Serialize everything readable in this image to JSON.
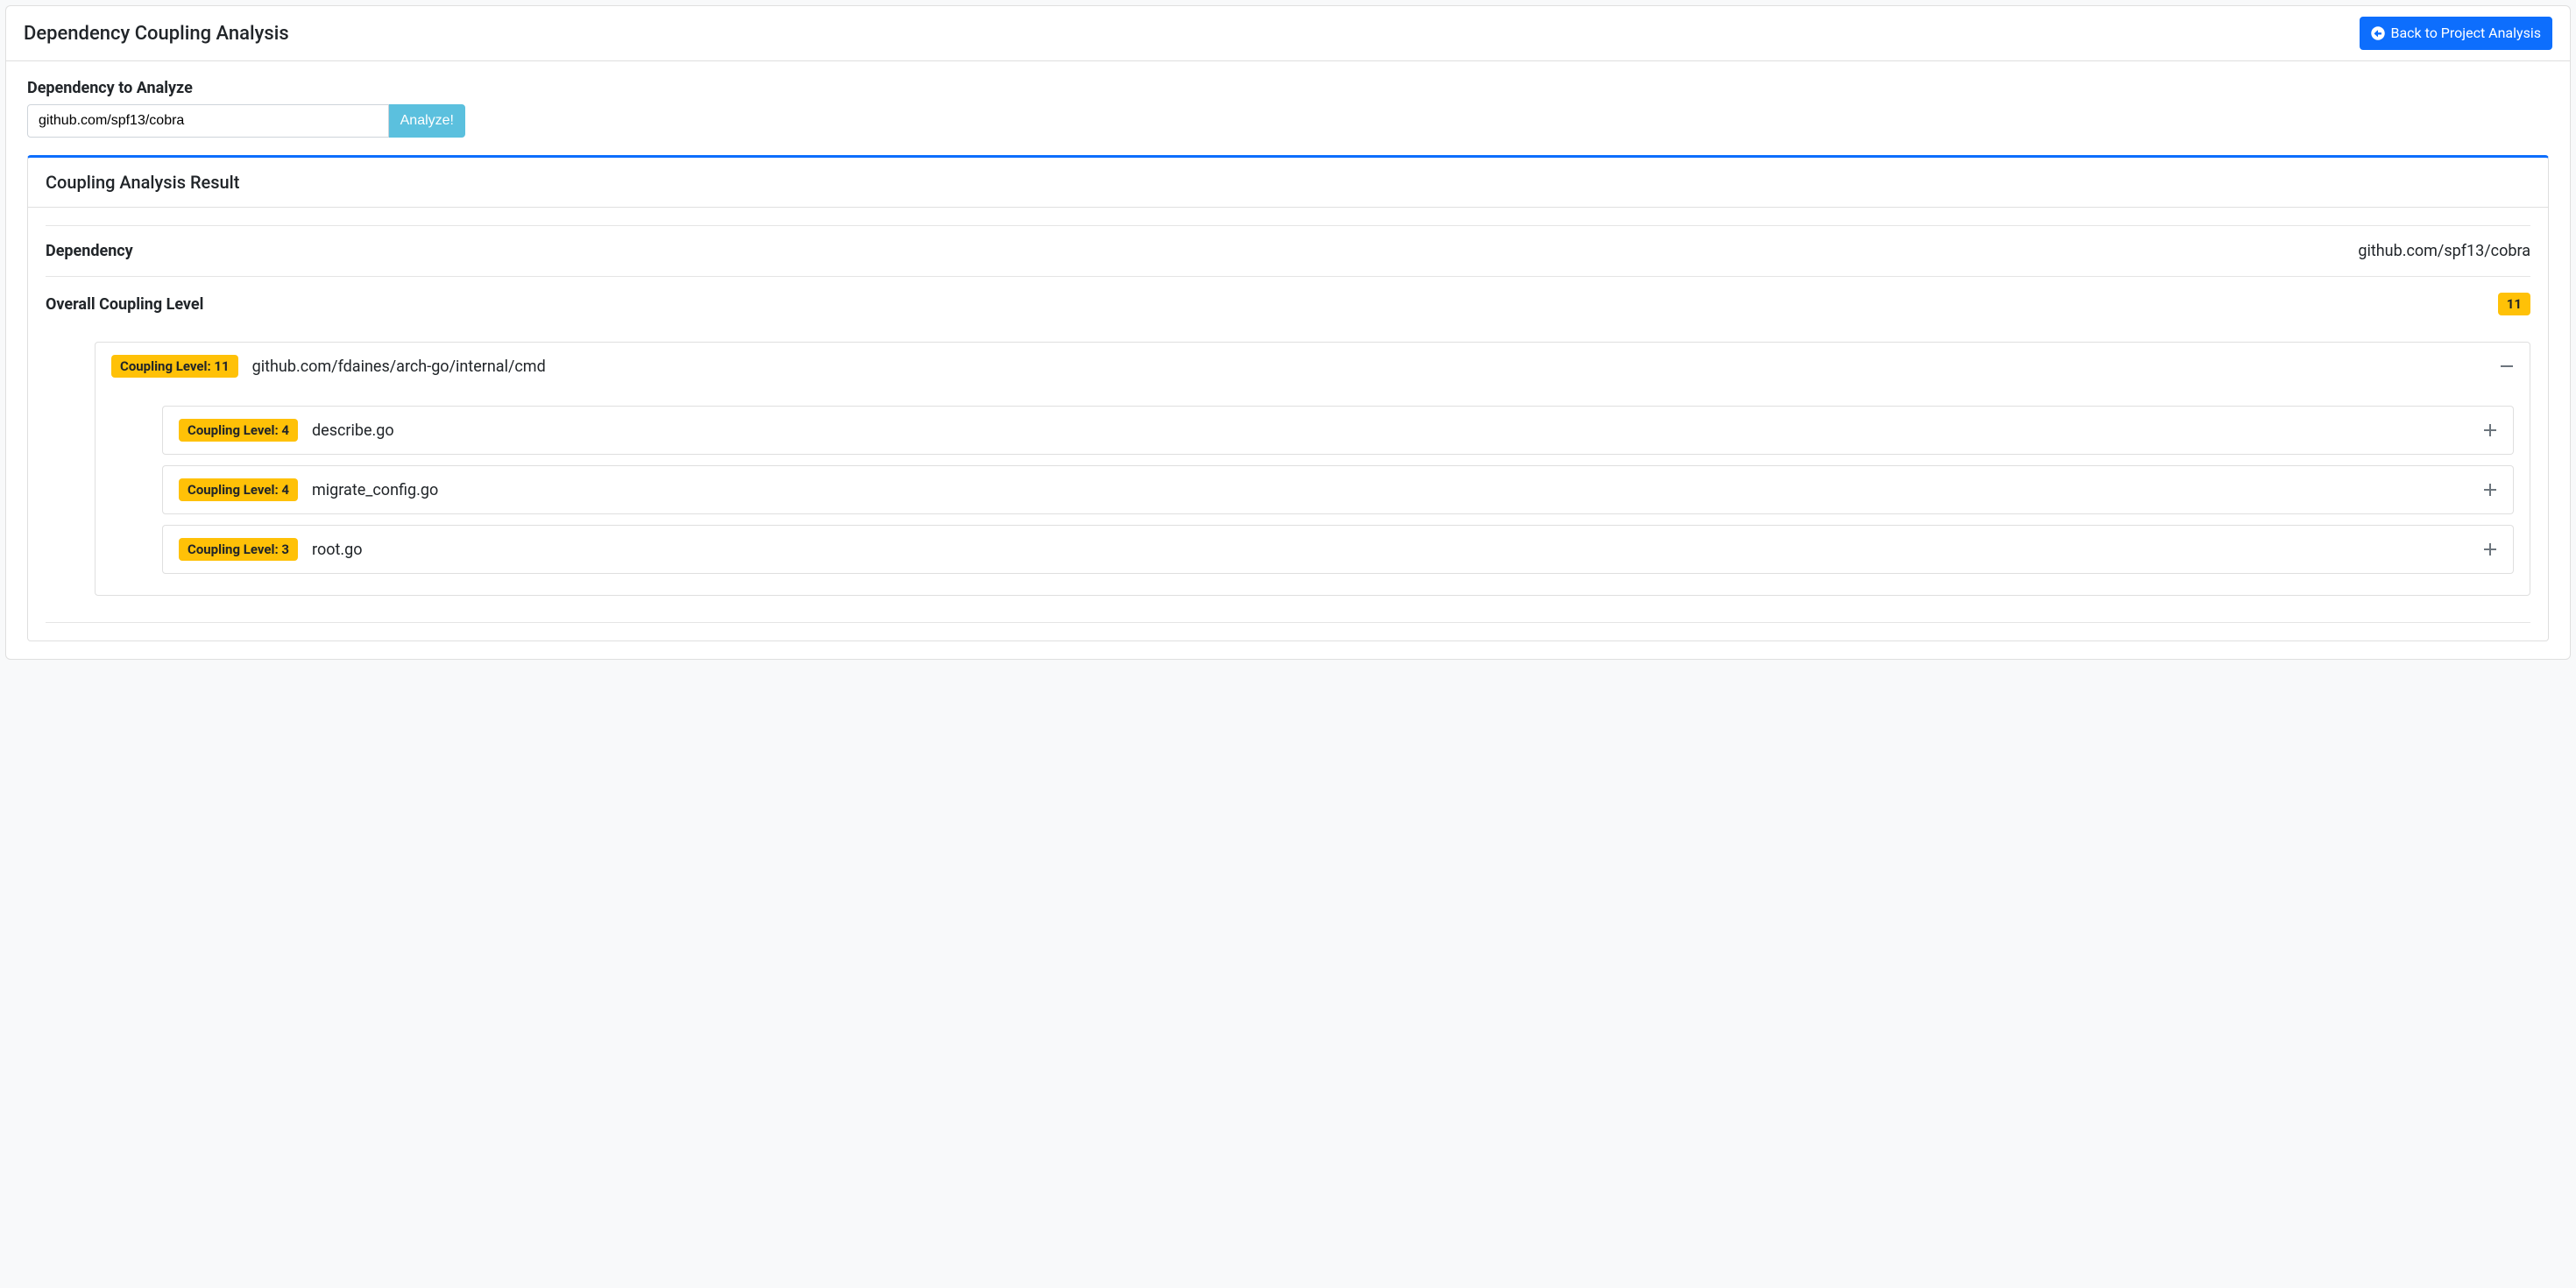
{
  "header": {
    "title": "Dependency Coupling Analysis",
    "back_button": "Back to Project Analysis"
  },
  "form": {
    "label": "Dependency to Analyze",
    "input_value": "github.com/spf13/cobra",
    "analyze_button": "Analyze!"
  },
  "result": {
    "title": "Coupling Analysis Result",
    "dependency_label": "Dependency",
    "dependency_value": "github.com/spf13/cobra",
    "overall_label": "Overall Coupling Level",
    "overall_value": "11",
    "tree": {
      "coupling_badge": "Coupling Level: 11",
      "package_path": "github.com/fdaines/arch-go/internal/cmd",
      "files": [
        {
          "coupling_badge": "Coupling Level: 4",
          "name": "describe.go"
        },
        {
          "coupling_badge": "Coupling Level: 4",
          "name": "migrate_config.go"
        },
        {
          "coupling_badge": "Coupling Level: 3",
          "name": "root.go"
        }
      ]
    }
  }
}
